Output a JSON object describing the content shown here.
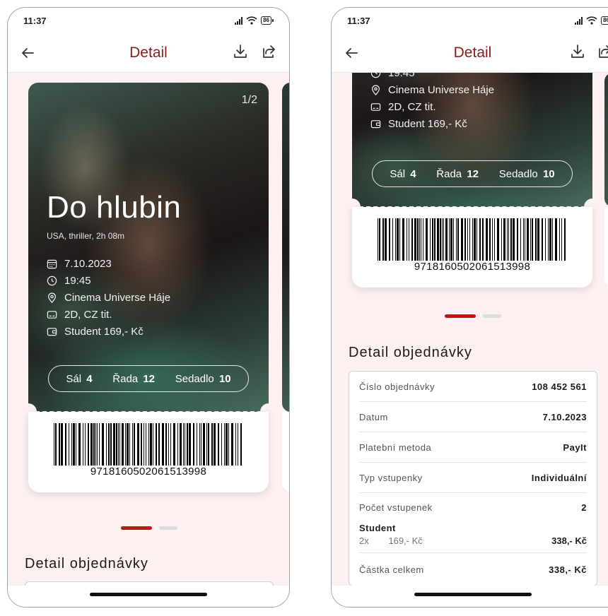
{
  "status": {
    "time": "11:37",
    "battery": "86"
  },
  "nav": {
    "title": "Detail"
  },
  "ticket": {
    "page_indicator": "1/2",
    "title": "Do hlubin",
    "meta": "USA, thriller, 2h 08m",
    "date": "7.10.2023",
    "time": "19:45",
    "cinema": "Cinema Universe Háje",
    "format": "2D, CZ tit.",
    "price": "Student 169,- Kč",
    "hall_label": "Sál",
    "hall": "4",
    "row_label": "Řada",
    "row": "12",
    "seat_label": "Sedadlo",
    "seat": "10",
    "barcode": "9718160502061513998"
  },
  "pager": {
    "count": 2,
    "active": 1
  },
  "order_section": {
    "title": "Detail objednávky",
    "rows": [
      {
        "label": "Číslo objednávky",
        "value": "108 452 561"
      },
      {
        "label": "Datum",
        "value": "7.10.2023"
      },
      {
        "label": "Platební metoda",
        "value": "PayIt"
      },
      {
        "label": "Typ vstupenky",
        "value": "Individuální"
      },
      {
        "label": "Počet vstupenek",
        "value": "2"
      }
    ],
    "group": {
      "title": "Student",
      "qty": "2x",
      "unit_price": "169,- Kč",
      "subtotal": "338,- Kč"
    },
    "total": {
      "label": "Částka celkem",
      "value": "338,- Kč"
    }
  },
  "colors": {
    "accent": "#8a1c1c",
    "pager_active": "#c01515",
    "background": "#fcf0f0"
  }
}
